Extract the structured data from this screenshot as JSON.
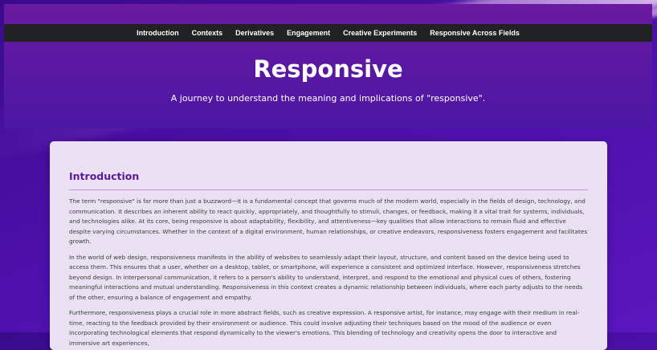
{
  "nav": {
    "items": [
      "Introduction",
      "Contexts",
      "Derivatives",
      "Engagement",
      "Creative Experiments",
      "Responsive Across Fields"
    ]
  },
  "hero": {
    "title": "Responsive",
    "subtitle": "A journey to understand the meaning and implications of \"responsive\"."
  },
  "main": {
    "section_title": "Introduction",
    "paragraphs": [
      "The term \"responsive\" is far more than just a buzzword—it is a fundamental concept that governs much of the modern world, especially in the fields of design, technology, and communication. It describes an inherent ability to react quickly, appropriately, and thoughtfully to stimuli, changes, or feedback, making it a vital trait for systems, individuals, and technologies alike. At its core, being responsive is about adaptability, flexibility, and attentiveness—key qualities that allow interactions to remain fluid and effective despite varying circumstances. Whether in the context of a digital environment, human relationships, or creative endeavors, responsiveness fosters engagement and facilitates growth.",
      "In the world of web design, responsiveness manifests in the ability of websites to seamlessly adapt their layout, structure, and content based on the device being used to access them. This ensures that a user, whether on a desktop, tablet, or smartphone, will experience a consistent and optimized interface. However, responsiveness stretches beyond design. In interpersonal communication, it refers to a person's ability to understand, interpret, and respond to the emotional and physical cues of others, fostering meaningful interactions and mutual understanding. Responsiveness in this context creates a dynamic relationship between individuals, where each party adjusts to the needs of the other, ensuring a balance of engagement and empathy.",
      "Furthermore, responsiveness plays a crucial role in more abstract fields, such as creative expression. A responsive artist, for instance, may engage with their medium in real-time, reacting to the feedback provided by their environment or audience. This could involve adjusting their techniques based on the mood of the audience or even incorporating technological elements that respond dynamically to the viewer's emotions. This blending of technology and creativity opens the door to interactive and immersive art experiences,"
    ]
  }
}
